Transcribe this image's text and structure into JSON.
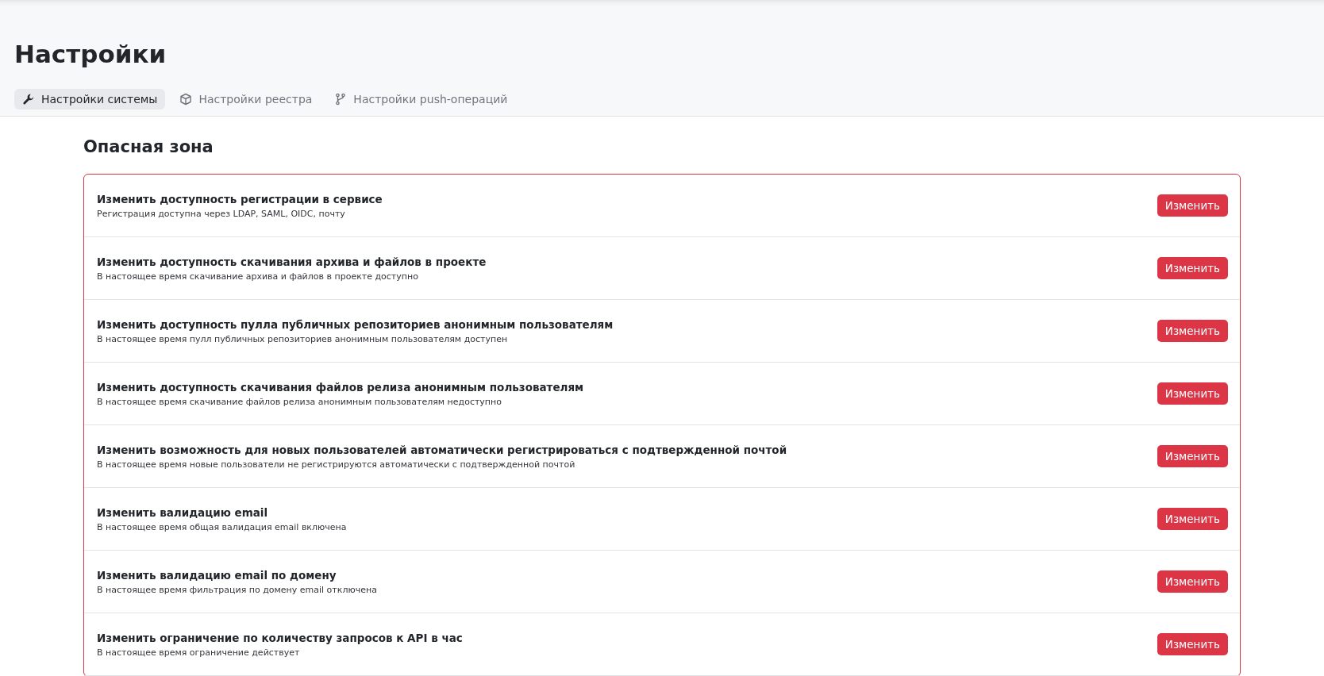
{
  "page_title": "Настройки",
  "tabs": [
    {
      "label": "Настройки системы",
      "selected": true
    },
    {
      "label": "Настройки реестра",
      "selected": false
    },
    {
      "label": "Настройки push-операций",
      "selected": false
    }
  ],
  "section_title": "Опасная зона",
  "rows": [
    {
      "title": "Изменить доступность регистрации в сервисе",
      "description": "Регистрация доступна через LDAP, SAML, OIDC, почту",
      "button": "Изменить"
    },
    {
      "title": "Изменить доступность скачивания архива и файлов в проекте",
      "description": "В настоящее время скачивание архива и файлов в проекте доступно",
      "button": "Изменить"
    },
    {
      "title": "Изменить доступность пулла публичных репозиториев анонимным пользователям",
      "description": "В настоящее время пулл публичных репозиториев анонимным пользователям доступен",
      "button": "Изменить"
    },
    {
      "title": "Изменить доступность скачивания файлов релиза анонимным пользователям",
      "description": "В настоящее время скачивание файлов релиза анонимным пользователям недоступно",
      "button": "Изменить"
    },
    {
      "title": "Изменить возможность для новых пользователей автоматически регистрироваться с подтвержденной почтой",
      "description": "В настоящее время новые пользователи не регистрируются автоматически с подтвержденной почтой",
      "button": "Изменить"
    },
    {
      "title": "Изменить валидацию email",
      "description": "В настоящее время общая валидация email включена",
      "button": "Изменить"
    },
    {
      "title": "Изменить валидацию email по домену",
      "description": "В настоящее время фильтрация по домену email отключена",
      "button": "Изменить"
    },
    {
      "title": "Изменить ограничение по количеству запросов к API в час",
      "description": "В настоящее время ограничение действует",
      "button": "Изменить"
    }
  ]
}
